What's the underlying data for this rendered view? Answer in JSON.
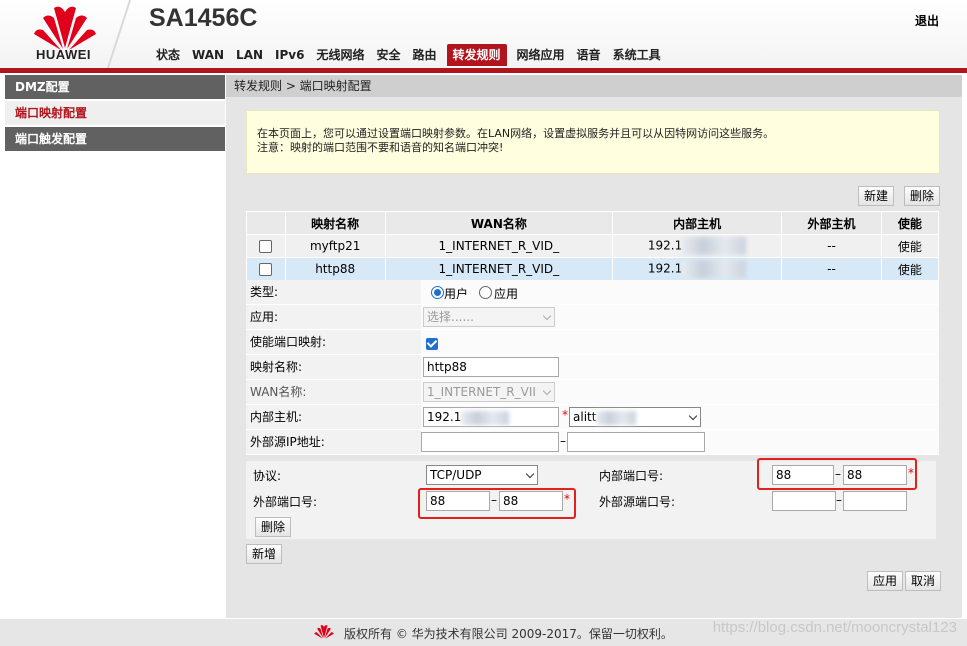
{
  "header": {
    "brand": "HUAWEI",
    "model": "SA1456C",
    "logout": "退出",
    "nav": [
      "状态",
      "WAN",
      "LAN",
      "IPv6",
      "无线网络",
      "安全",
      "路由",
      "转发规则",
      "网络应用",
      "语音",
      "系统工具"
    ],
    "active_nav": "转发规则",
    "brand_color": "#b0141c"
  },
  "sidebar": {
    "items": [
      {
        "label": "DMZ配置"
      },
      {
        "label": "端口映射配置"
      },
      {
        "label": "端口触发配置"
      }
    ]
  },
  "breadcrumb": "转发规则 > 端口映射配置",
  "notice": {
    "line1": "在本页面上，您可以通过设置端口映射参数。在LAN网络，设置虚拟服务并且可以从因特网访问这些服务。",
    "line2": "注意：映射的端口范围不要和语音的知名端口冲突!"
  },
  "toolbar": {
    "new": "新建",
    "delete": "删除"
  },
  "table": {
    "headers": [
      "映射名称",
      "WAN名称",
      "内部主机",
      "外部主机",
      "使能"
    ],
    "rows": [
      {
        "name": "myftp21",
        "wan": "1_INTERNET_R_VID_",
        "host": "192.1",
        "ext": "--",
        "enable": "使能",
        "selected": false
      },
      {
        "name": "http88",
        "wan": "1_INTERNET_R_VID_",
        "host": "192.1",
        "ext": "--",
        "enable": "使能",
        "selected": true
      }
    ]
  },
  "form": {
    "type_label": "类型:",
    "type_user": "用户",
    "type_app": "应用",
    "app_label": "应用:",
    "app_placeholder": "选择......",
    "enable_label": "使能端口映射:",
    "name_label": "映射名称:",
    "name_value": "http88",
    "wan_label": "WAN名称:",
    "wan_value": "1_INTERNET_R_VII",
    "host_label": "内部主机:",
    "host_value": "192.1",
    "host_select": "alitt",
    "src_ip_label": "外部源IP地址:",
    "protocol_label": "协议:",
    "protocol_value": "TCP/UDP",
    "int_port_label": "内部端口号:",
    "int_port_start": "88",
    "int_port_end": "88",
    "ext_port_label": "外部端口号:",
    "ext_port_start": "88",
    "ext_port_end": "88",
    "ext_src_port_label": "外部源端口号:",
    "delete": "删除",
    "add": "新增"
  },
  "actions": {
    "apply": "应用",
    "cancel": "取消"
  },
  "footer": {
    "copyright": "版权所有 © 华为技术有限公司 2009-2017。保留一切权利。",
    "watermark": "https://blog.csdn.net/mooncrystal123"
  }
}
